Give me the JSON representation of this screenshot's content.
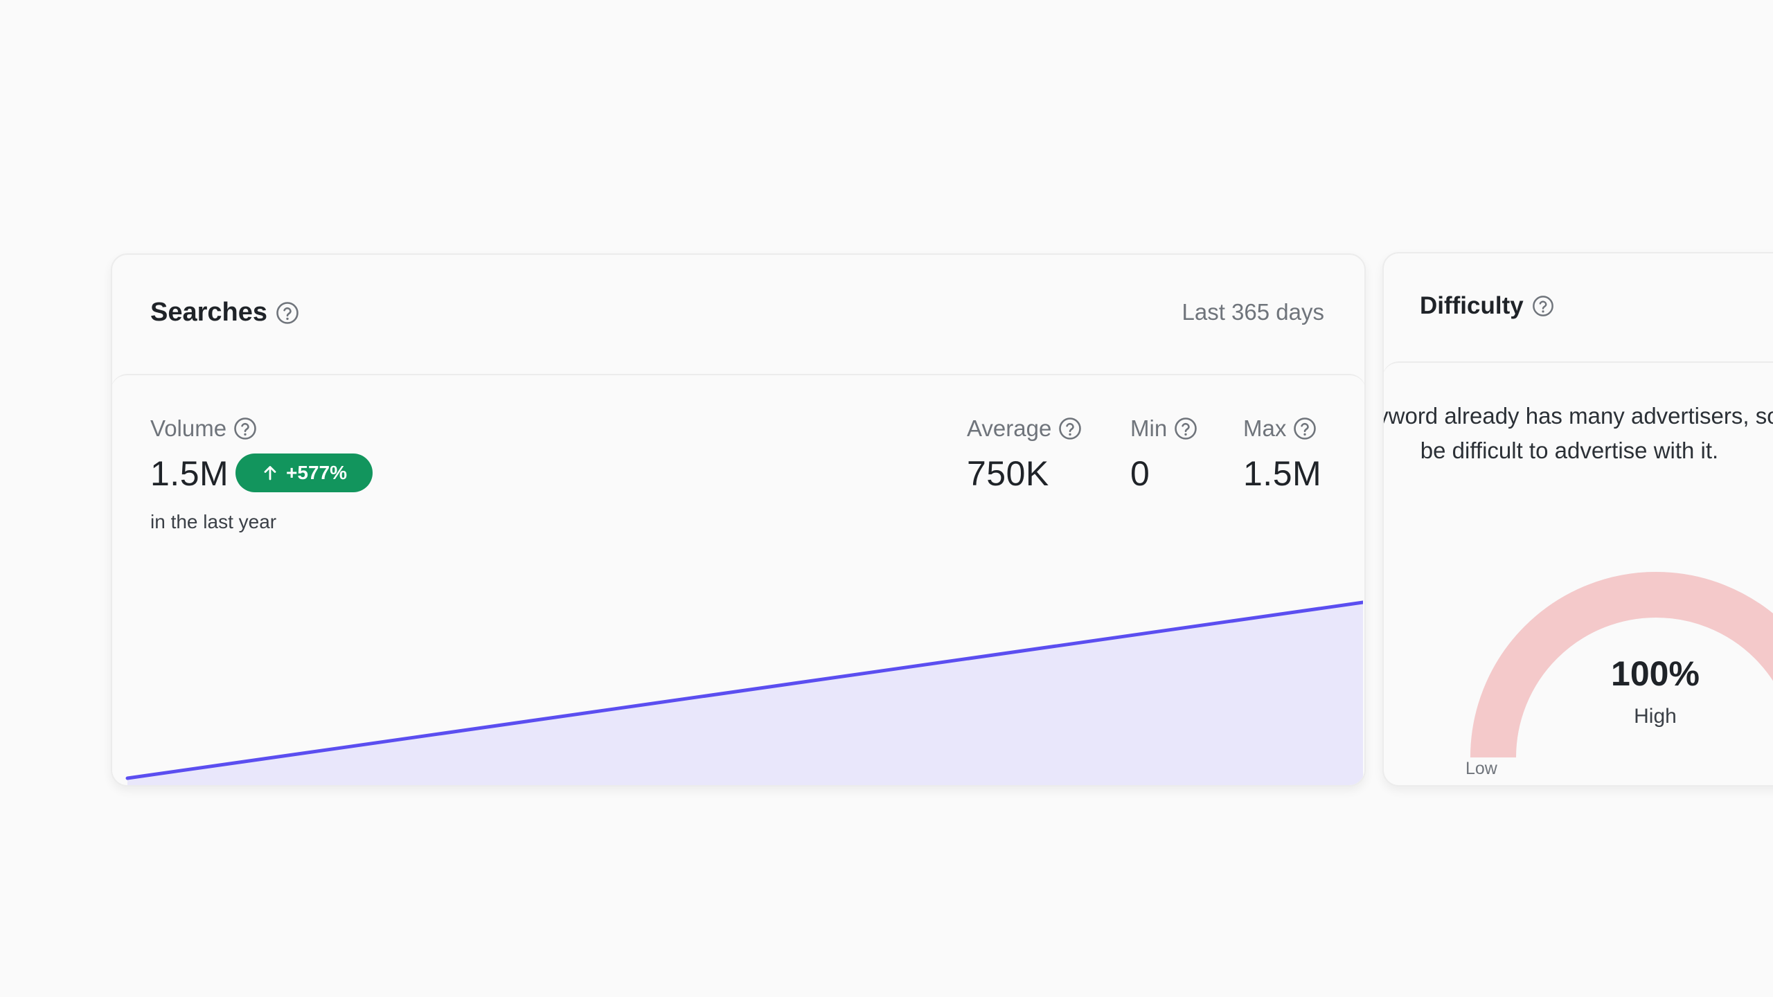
{
  "searches": {
    "title": "Searches",
    "period": "Last 365 days",
    "volume": {
      "label": "Volume",
      "value": "1.5M",
      "change": "+577%",
      "subtext": "in the last year"
    },
    "average": {
      "label": "Average",
      "value": "750K"
    },
    "min": {
      "label": "Min",
      "value": "0"
    },
    "max": {
      "label": "Max",
      "value": "1.5M"
    }
  },
  "chart_data": {
    "type": "area",
    "x": [
      0,
      1
    ],
    "values": [
      0,
      1500000
    ],
    "ylim": [
      0,
      1500000
    ],
    "grid": false,
    "line_color": "#5b4ef0",
    "fill_color": "#e9e7fb"
  },
  "difficulty": {
    "title": "Difficulty",
    "description": "This keyword already has many advertisers, so it will be difficult to advertise with it.",
    "percent": "100%",
    "percent_value": 100,
    "level": "High",
    "low_label": "Low",
    "gauge_color": "#f4c9ca"
  },
  "colors": {
    "badge": "#12955d",
    "muted_text": "#6f747b"
  }
}
